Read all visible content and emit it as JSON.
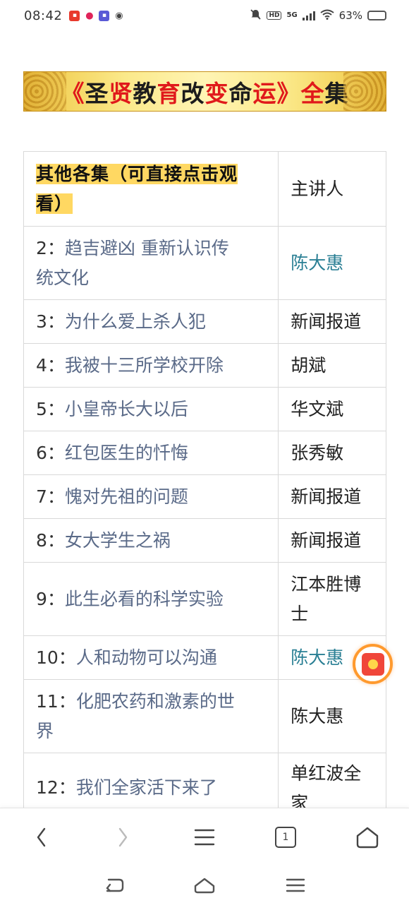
{
  "status": {
    "time": "08:42",
    "network": "5G",
    "battery": "63%",
    "battery_level": 0.63
  },
  "banner": {
    "title_parts": [
      {
        "text": "《",
        "color": "red"
      },
      {
        "text": "圣",
        "color": "dark"
      },
      {
        "text": "贤",
        "color": "red"
      },
      {
        "text": "教",
        "color": "dark"
      },
      {
        "text": "育",
        "color": "red"
      },
      {
        "text": "改",
        "color": "dark"
      },
      {
        "text": "变",
        "color": "red"
      },
      {
        "text": "命",
        "color": "dark"
      },
      {
        "text": "运",
        "color": "red"
      },
      {
        "text": "》",
        "color": "red"
      },
      {
        "text": "全",
        "color": "red"
      },
      {
        "text": "集",
        "color": "dark"
      }
    ]
  },
  "table": {
    "header": {
      "col1_line1": "其他各集（可直接点击观",
      "col1_line2": "看）",
      "col2": "主讲人"
    },
    "rows": [
      {
        "num": "2：",
        "title": "趋吉避凶 重新认识传",
        "title2": "统文化",
        "speaker": "陈大惠",
        "speaker_link": true
      },
      {
        "num": "3：",
        "title": "为什么爱上杀人犯",
        "speaker": "新闻报道",
        "speaker_link": false
      },
      {
        "num": "4：",
        "title": "我被十三所学校开除",
        "speaker": "胡斌",
        "speaker_link": false
      },
      {
        "num": "5：",
        "title": "小皇帝长大以后",
        "speaker": "华文斌",
        "speaker_link": false
      },
      {
        "num": "6：",
        "title": "红包医生的忏悔",
        "speaker": "张秀敏",
        "speaker_link": false
      },
      {
        "num": "7：",
        "title": "愧对先祖的问题",
        "speaker": "新闻报道",
        "speaker_link": false
      },
      {
        "num": "8：",
        "title": "女大学生之祸",
        "speaker": "新闻报道",
        "speaker_link": false
      },
      {
        "num": "9：",
        "title": "此生必看的科学实验",
        "speaker": "江本胜博",
        "speaker2": "士",
        "speaker_link": false
      },
      {
        "num": "10：",
        "title": "人和动物可以沟通",
        "speaker": "陈大惠",
        "speaker_link": true
      },
      {
        "num": "11：",
        "title": "化肥农药和激素的世",
        "title2": "界",
        "speaker": "陈大惠",
        "speaker_link": false
      },
      {
        "num": "12：",
        "title": "我们全家活下来了",
        "speaker": "单红波全",
        "speaker2": "家",
        "speaker_link": false
      }
    ]
  },
  "browser_bar": {
    "icons": [
      "back-icon",
      "forward-icon",
      "menu-icon",
      "tabs-icon",
      "home-icon"
    ],
    "tab_count": "1"
  },
  "system_nav": {
    "icons": [
      "system-back-icon",
      "system-home-icon",
      "system-recents-icon"
    ]
  },
  "colors": {
    "highlight": "#ffd862",
    "link": "#5a6a88",
    "speaker_link": "#2a7f94",
    "banner_red": "#e0191b"
  }
}
